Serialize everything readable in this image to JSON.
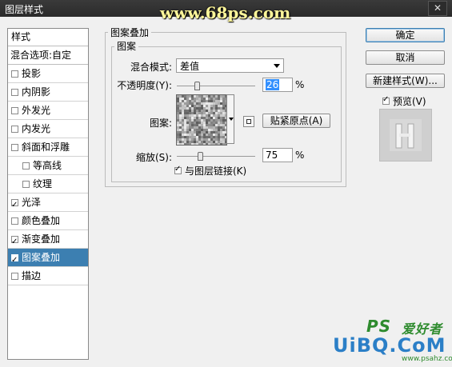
{
  "window": {
    "title": "图层样式",
    "close_label": "✕"
  },
  "watermark_text": "www.68ps.com",
  "styles": {
    "header": "样式",
    "blend_options": "混合选项:自定",
    "items": [
      {
        "label": "投影",
        "checked": false,
        "sub": false,
        "active": false
      },
      {
        "label": "内阴影",
        "checked": false,
        "sub": false,
        "active": false
      },
      {
        "label": "外发光",
        "checked": false,
        "sub": false,
        "active": false
      },
      {
        "label": "内发光",
        "checked": false,
        "sub": false,
        "active": false
      },
      {
        "label": "斜面和浮雕",
        "checked": false,
        "sub": false,
        "active": false
      },
      {
        "label": "等高线",
        "checked": false,
        "sub": true,
        "active": false
      },
      {
        "label": "纹理",
        "checked": false,
        "sub": true,
        "active": false
      },
      {
        "label": "光泽",
        "checked": true,
        "sub": false,
        "active": false
      },
      {
        "label": "颜色叠加",
        "checked": false,
        "sub": false,
        "active": false
      },
      {
        "label": "渐变叠加",
        "checked": true,
        "sub": false,
        "active": false
      },
      {
        "label": "图案叠加",
        "checked": true,
        "sub": false,
        "active": true
      },
      {
        "label": "描边",
        "checked": false,
        "sub": false,
        "active": false
      }
    ]
  },
  "overlay": {
    "section_title": "图案叠加",
    "group_title": "图案",
    "blend_mode_label": "混合模式:",
    "blend_mode_value": "差值",
    "opacity_label": "不透明度(Y):",
    "opacity_value": "26",
    "opacity_level": 0.26,
    "percent": "%",
    "pattern_label": "图案:",
    "snap_button": "贴紧原点(A)",
    "scale_label": "缩放(S):",
    "scale_value": "75",
    "scale_level": 0.3,
    "link_label": "与图层链接(K)",
    "link_checked": true
  },
  "buttons": {
    "ok": "确定",
    "cancel": "取消",
    "new_style": "新建样式(W)...",
    "preview_label": "预览(V)",
    "preview_checked": true
  },
  "branding": {
    "logo": "UiBQ.CoM",
    "ps": "PS",
    "sub": "爱好者",
    "site": "www.psahz.com"
  }
}
